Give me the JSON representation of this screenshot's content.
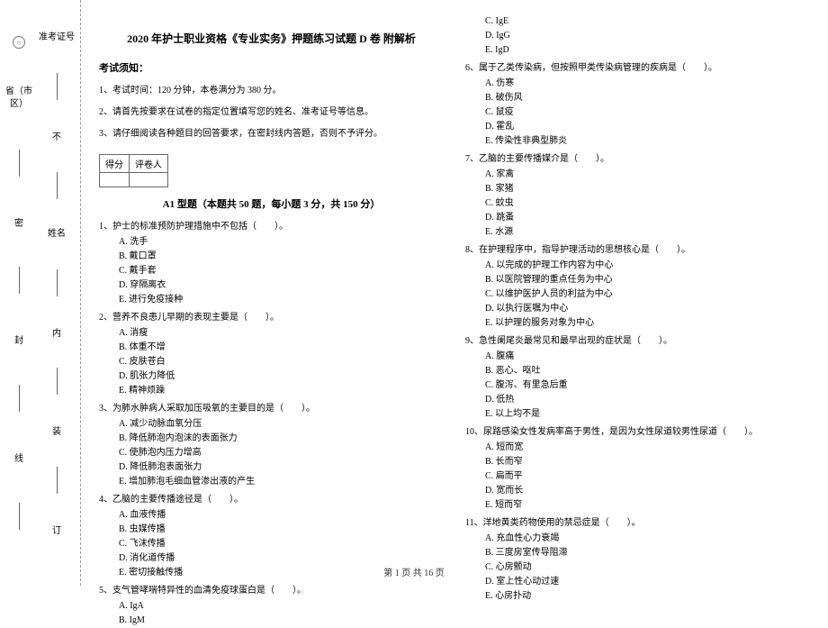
{
  "margin": {
    "col_a": {
      "label1": "省（市区）",
      "seal": [
        "密",
        "封",
        "线"
      ]
    },
    "col_b": {
      "label_top": "准考证号",
      "label_mid": "姓名",
      "seal": [
        "不",
        "内",
        "装",
        "订"
      ],
      "circ": "圆"
    }
  },
  "title": "2020 年护士职业资格《专业实务》押题练习试题 D 卷 附解析",
  "notice_head": "考试须知：",
  "instructions": [
    "1、考试时间：120 分钟，本卷满分为 380 分。",
    "2、请首先按要求在试卷的指定位置填写您的姓名、准考证号等信息。",
    "3、请仔细阅读各种题目的回答要求，在密封线内答题，否则不予评分。"
  ],
  "score_table": {
    "c1": "得分",
    "c2": "评卷人"
  },
  "type_a_head": "A1 型题（本题共 50 题，每小题 3 分，共 150 分）",
  "questions_left": [
    {
      "stem": "1、护士的标准预防护理措施中不包括（　　）。",
      "opts": [
        "A. 洗手",
        "B. 戴口罩",
        "C. 戴手套",
        "D. 穿隔离衣",
        "E. 进行免疫接种"
      ]
    },
    {
      "stem": "2、营养不良患儿早期的表现主要是（　　）。",
      "opts": [
        "A. 消瘦",
        "B. 体重不增",
        "C. 皮肤苍白",
        "D. 肌张力降低",
        "E. 精神烦躁"
      ]
    },
    {
      "stem": "3、为肺水肿病人采取加压吸氧的主要目的是（　　）。",
      "opts": [
        "A. 减少动脉血氧分压",
        "B. 降低肺泡内泡沫的表面张力",
        "C. 使肺泡内压力增高",
        "D. 降低肺泡表面张力",
        "E. 增加肺泡毛细血管渗出液的产生"
      ]
    },
    {
      "stem": "4、乙脑的主要传播途径是（　　）。",
      "opts": [
        "A. 血液传播",
        "B. 虫媒传播",
        "C. 飞沫传播",
        "D. 消化道传播",
        "E. 密切接触传播"
      ]
    },
    {
      "stem": "5、支气管哮喘特异性的血清免疫球蛋白是（　　）。",
      "opts": [
        "A. IgA",
        "B. IgM"
      ]
    }
  ],
  "q5_extra": [
    "C. IgE",
    "D. IgG",
    "E. IgD"
  ],
  "questions_right": [
    {
      "stem": "6、属于乙类传染病，但按照甲类传染病管理的疾病是（　　）。",
      "opts": [
        "A. 伤寒",
        "B. 破伤风",
        "C. 鼠疫",
        "D. 霍乱",
        "E. 传染性非典型肺炎"
      ]
    },
    {
      "stem": "7、乙脑的主要传播媒介是（　　）。",
      "opts": [
        "A. 家禽",
        "B. 家猪",
        "C. 蚊虫",
        "D. 跳蚤",
        "E. 水源"
      ]
    },
    {
      "stem": "8、在护理程序中，指导护理活动的思想核心是（　　）。",
      "opts": [
        "A. 以完成的护理工作内容为中心",
        "B. 以医院管理的重点任务为中心",
        "C. 以维护医护人员的利益为中心",
        "D. 以执行医嘱为中心",
        "E. 以护理的服务对象为中心"
      ]
    },
    {
      "stem": "9、急性阑尾炎最常见和最早出现的症状是（　　）。",
      "opts": [
        "A. 腹痛",
        "B. 恶心、呕吐",
        "C. 腹泻、有里急后重",
        "D. 低热",
        "E. 以上均不是"
      ]
    },
    {
      "stem": "10、尿路感染女性发病率高于男性，是因为女性尿道较男性尿道（　　）。",
      "opts": [
        "A. 短而宽",
        "B. 长而窄",
        "C. 扁而平",
        "D. 宽而长",
        "E. 短而窄"
      ]
    },
    {
      "stem": "11、洋地黄类药物使用的禁忌症是（　　）。",
      "opts": [
        "A. 充血性心力衰竭",
        "B. 三度房室传导阻滞",
        "C. 心房颤动",
        "D. 室上性心动过速",
        "E. 心房扑动"
      ]
    }
  ],
  "footer": "第 1 页 共 16 页"
}
